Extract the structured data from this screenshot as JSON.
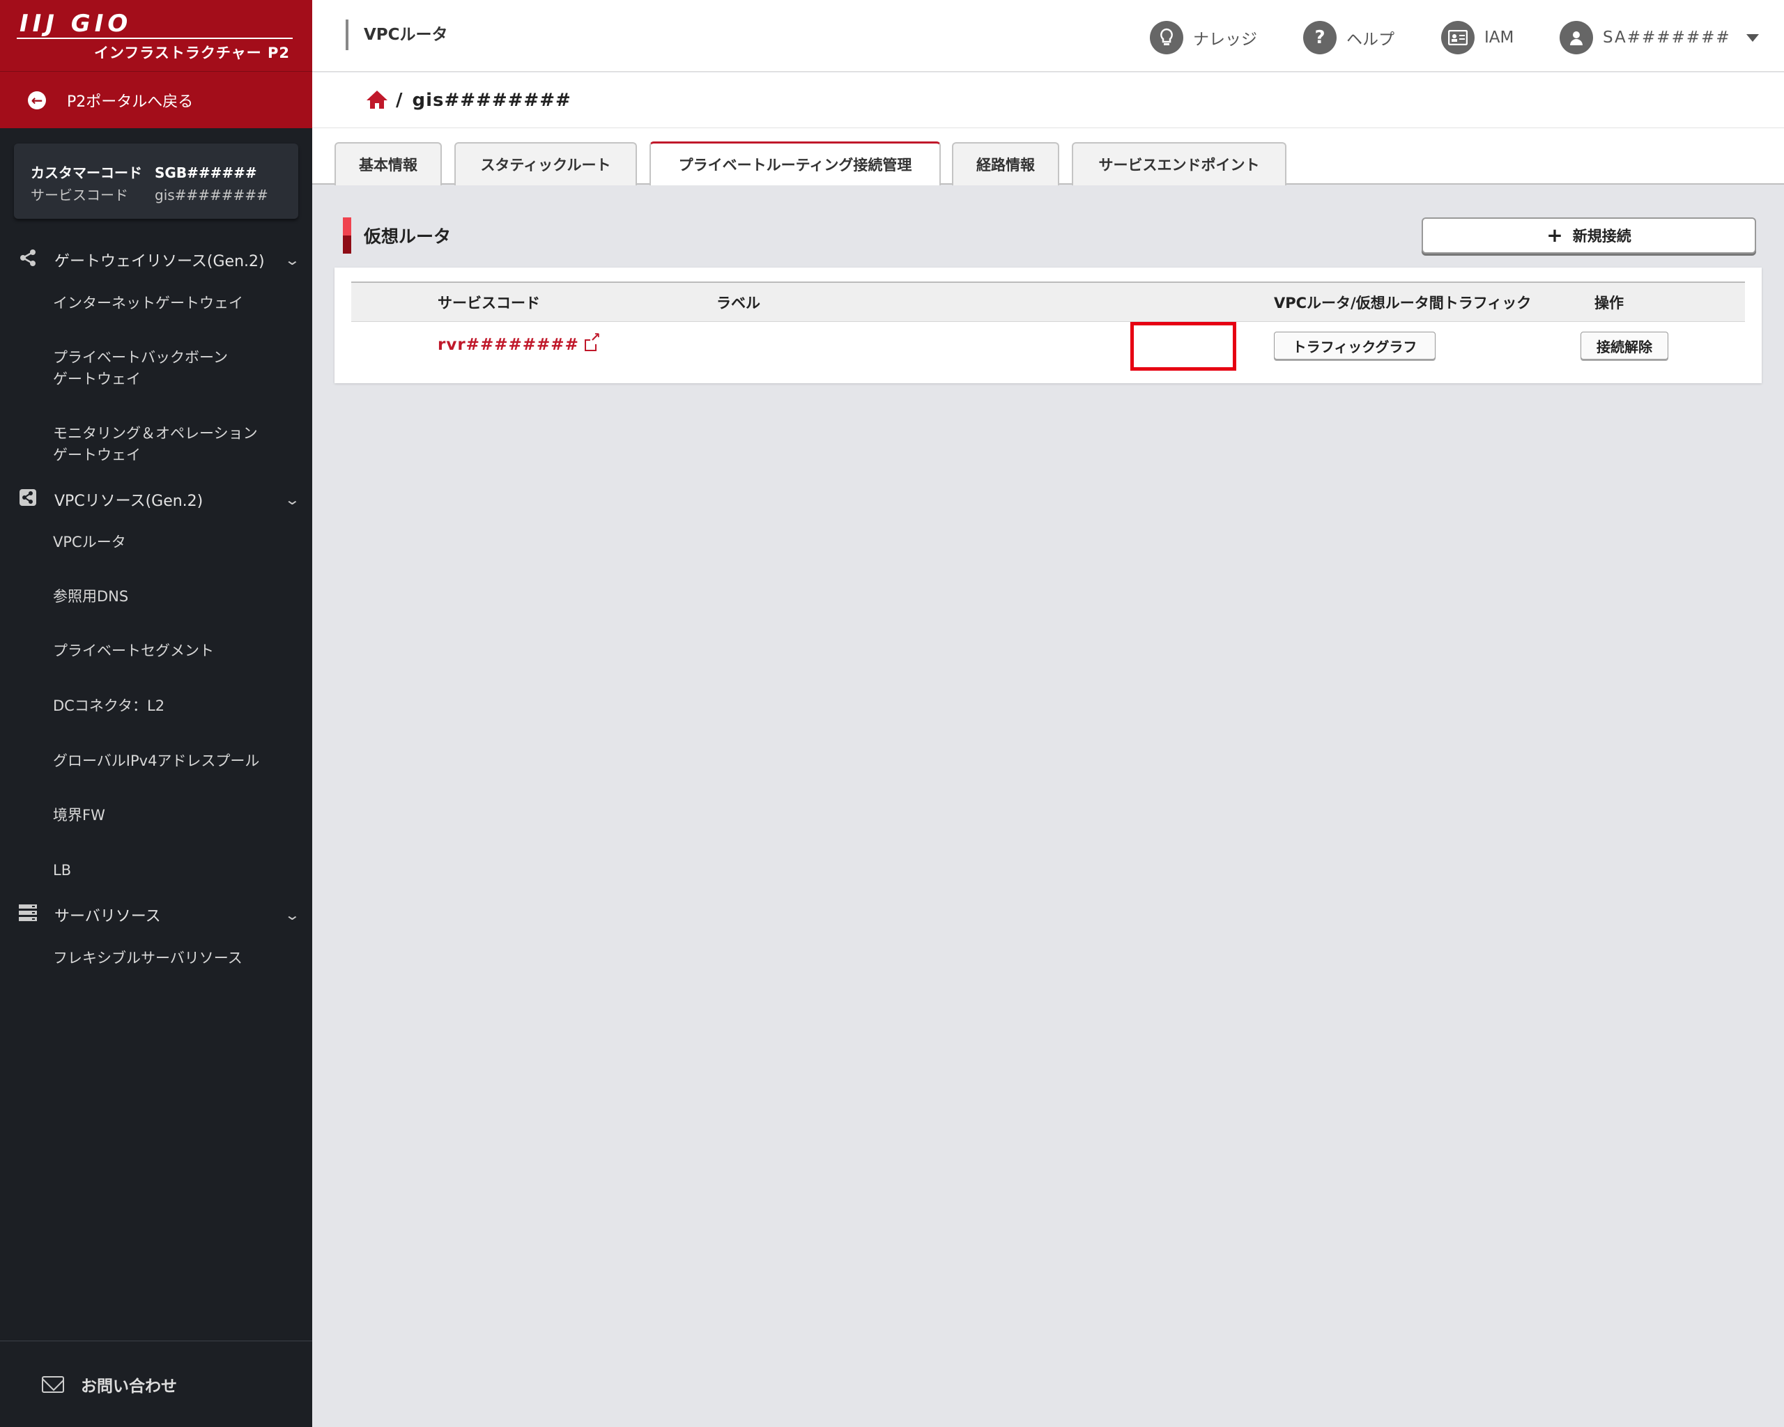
{
  "brand": {
    "logo": "IIJ GIO",
    "subtitle": "インフラストラクチャー P2"
  },
  "sidebar": {
    "back_label": "P2ポータルへ戻る",
    "customer_code_label": "カスタマーコード",
    "customer_code_value": "SGB######",
    "service_code_label": "サービスコード",
    "service_code_value": "gis########",
    "groups": [
      {
        "label": "ゲートウェイリソース(Gen.2)",
        "icon": "share-icon"
      },
      {
        "label": "VPCリソース(Gen.2)",
        "icon": "share-square-icon"
      },
      {
        "label": "サーバリソース",
        "icon": "server-icon"
      }
    ],
    "gateway_items": [
      "インターネットゲートウェイ",
      "プライベートバックボーン\nゲートウェイ",
      "モニタリング＆オペレーション\nゲートウェイ"
    ],
    "vpc_items": [
      "VPCルータ",
      "参照用DNS",
      "プライベートセグメント",
      "DCコネクタ：L2",
      "グローバルIPv4アドレスプール",
      "境界FW",
      "LB"
    ],
    "server_items": [
      "フレキシブルサーバリソース"
    ],
    "contact_label": "お問い合わせ"
  },
  "header": {
    "section_title": "VPCルータ",
    "nav": [
      {
        "label": "ナレッジ",
        "icon": "lightbulb-icon"
      },
      {
        "label": "ヘルプ",
        "icon": "help-icon"
      },
      {
        "label": "IAM",
        "icon": "id-card-icon"
      },
      {
        "label": "SA#######",
        "icon": "user-icon"
      }
    ]
  },
  "breadcrumb": {
    "separator": "/",
    "current": "gis########"
  },
  "tabs": [
    "基本情報",
    "スタティックルート",
    "プライベートルーティング接続管理",
    "経路情報",
    "サービスエンドポイント"
  ],
  "active_tab": "プライベートルーティング接続管理",
  "content": {
    "section_title": "仮想ルータ",
    "new_button": "新規接続",
    "table": {
      "headers": [
        "サービスコード",
        "ラベル",
        "VPCルータ/仮想ルータ間トラフィック",
        "操作"
      ],
      "rows": [
        {
          "service_code": "rvr########",
          "label": "",
          "traffic_button": "トラフィックグラフ",
          "action_button": "接続解除"
        }
      ]
    }
  },
  "colors": {
    "brand_red": "#a30d1a",
    "link_red": "#c0182a",
    "highlight": "#e60012",
    "sidebar_bg": "#1c1f24"
  }
}
